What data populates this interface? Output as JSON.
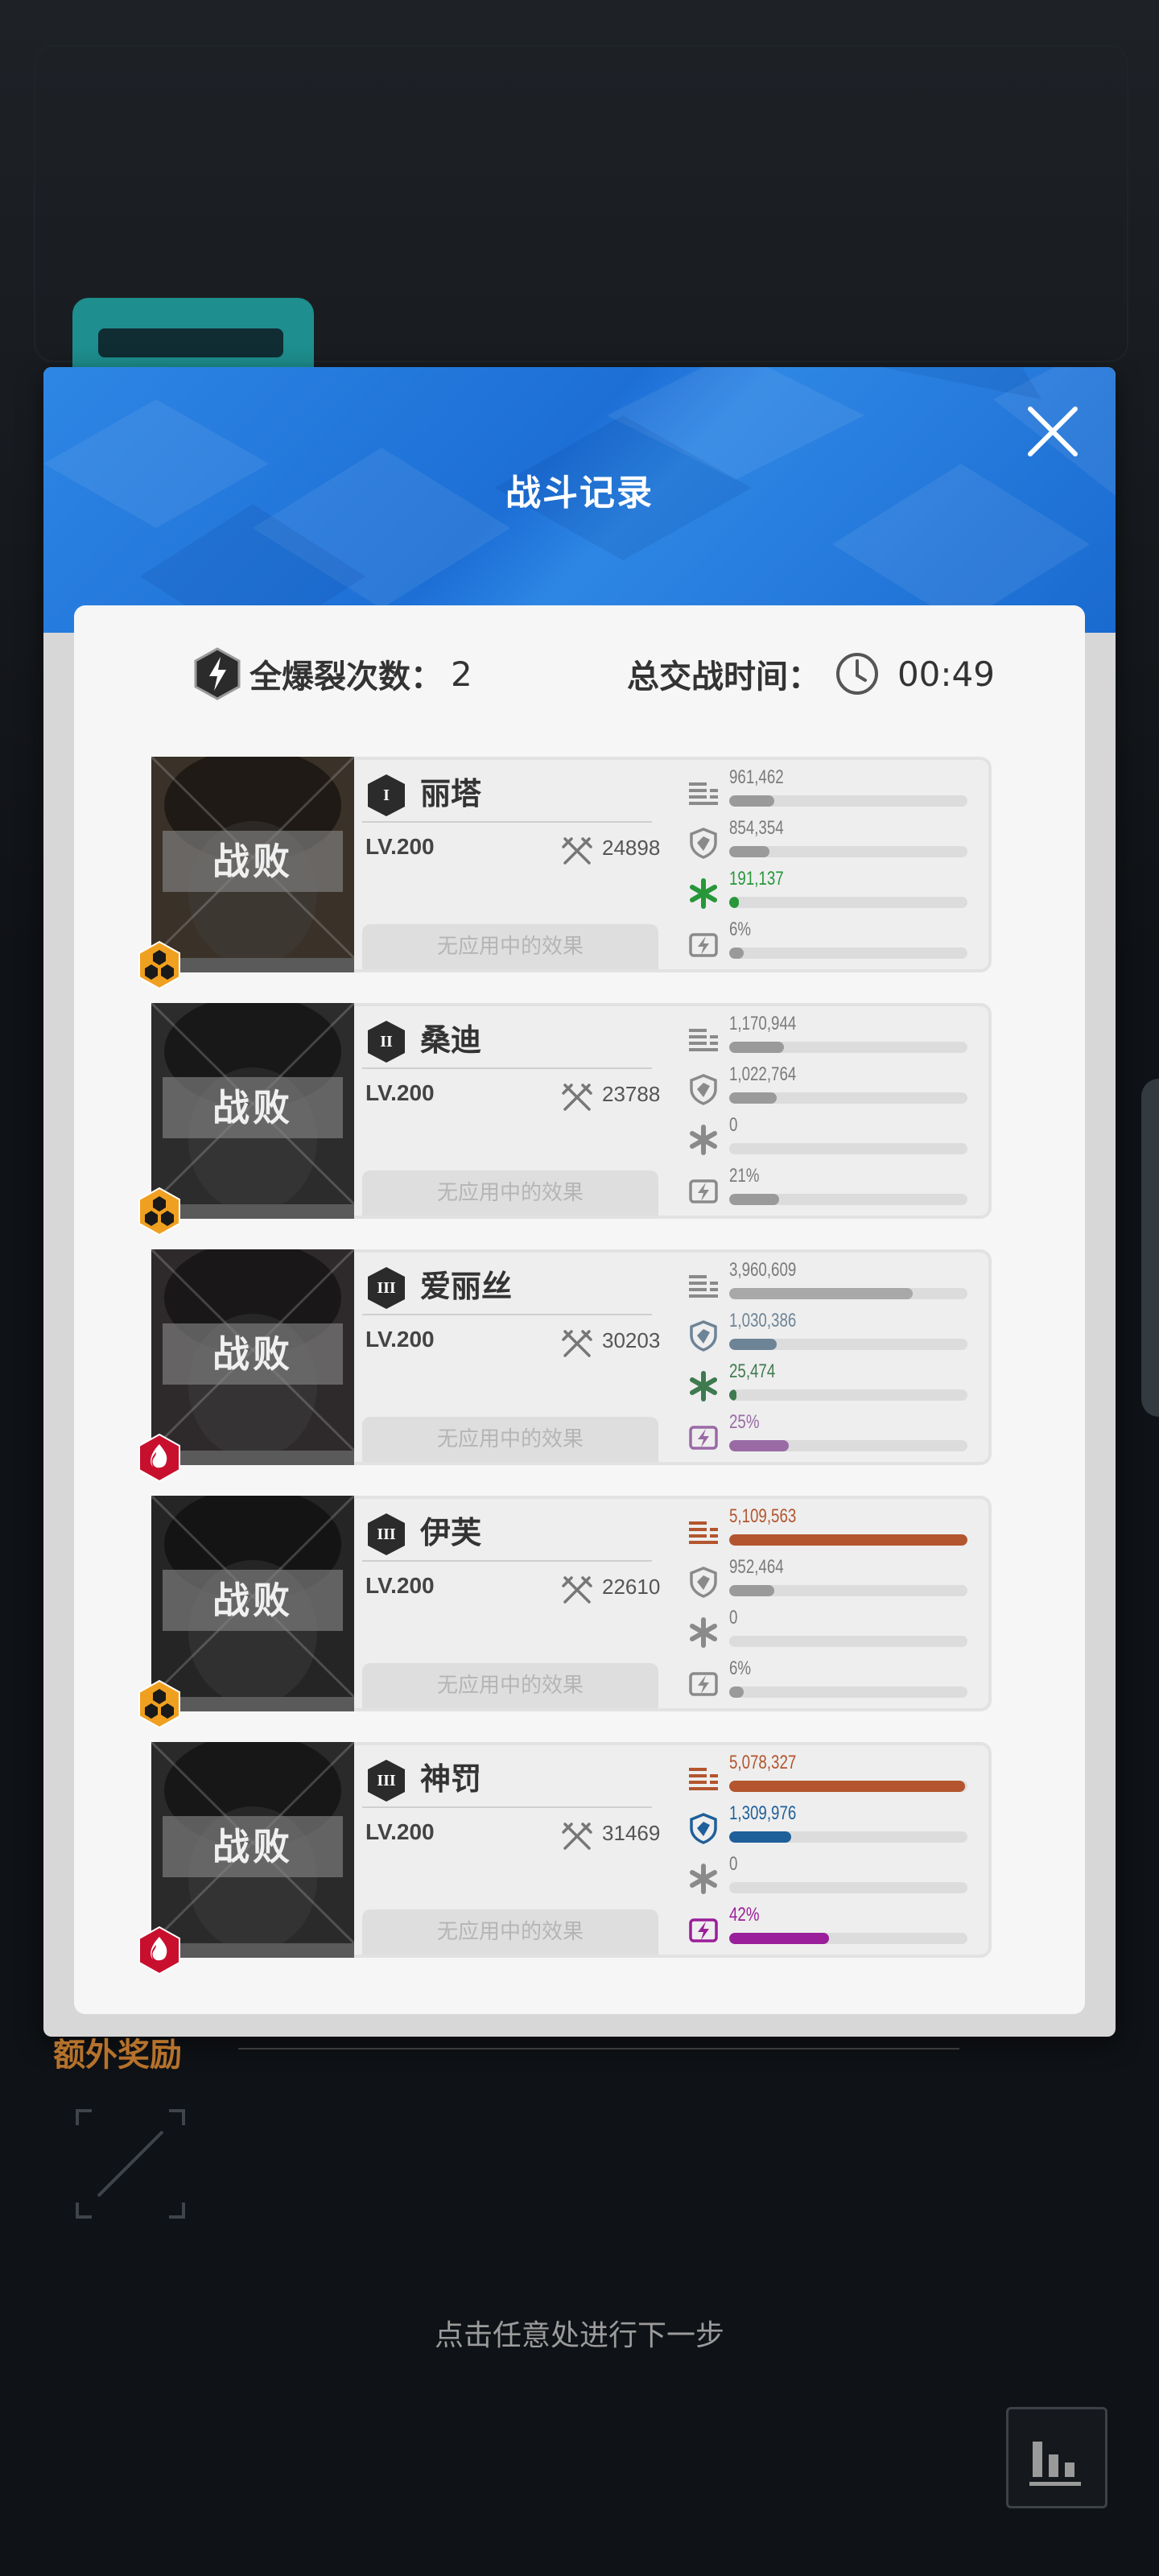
{
  "dialog": {
    "title": "战斗记录",
    "close_icon": "close-icon"
  },
  "summary": {
    "burst_label": "全爆裂次数：",
    "burst_value": "2",
    "time_label": "总交战时间：",
    "time_value": "00:49"
  },
  "characters": [
    {
      "name": "丽塔",
      "rank": "I",
      "level": "LV.200",
      "power": "24898",
      "status": "战败",
      "effects": "无应用中的效果",
      "element": "iron",
      "stats": {
        "damage": {
          "value": "961,462",
          "fraction": 0.19,
          "color": "#9a9a9a"
        },
        "taken": {
          "value": "854,354",
          "fraction": 0.17,
          "color": "#9a9a9a"
        },
        "heal": {
          "value": "191,137",
          "fraction": 0.04,
          "color": "#27973a",
          "highlight": true
        },
        "burst": {
          "value": "6%",
          "fraction": 0.06,
          "color": "#9a9a9a"
        }
      }
    },
    {
      "name": "桑迪",
      "rank": "II",
      "level": "LV.200",
      "power": "23788",
      "status": "战败",
      "effects": "无应用中的效果",
      "element": "iron",
      "stats": {
        "damage": {
          "value": "1,170,944",
          "fraction": 0.23,
          "color": "#9a9a9a"
        },
        "taken": {
          "value": "1,022,764",
          "fraction": 0.2,
          "color": "#9a9a9a"
        },
        "heal": {
          "value": "0",
          "fraction": 0.0,
          "color": "#9a9a9a"
        },
        "burst": {
          "value": "21%",
          "fraction": 0.21,
          "color": "#9a9a9a"
        }
      }
    },
    {
      "name": "爱丽丝",
      "rank": "III",
      "level": "LV.200",
      "power": "30203",
      "status": "战败",
      "effects": "无应用中的效果",
      "element": "fire",
      "stats": {
        "damage": {
          "value": "3,960,609",
          "fraction": 0.77,
          "color": "#a8a8a8"
        },
        "taken": {
          "value": "1,030,386",
          "fraction": 0.2,
          "color": "#6d8396",
          "highlight": true
        },
        "heal": {
          "value": "25,474",
          "fraction": 0.01,
          "color": "#3f7a4f",
          "highlight": true
        },
        "burst": {
          "value": "25%",
          "fraction": 0.25,
          "color": "#9a6aa5",
          "highlight": true
        }
      }
    },
    {
      "name": "伊芙",
      "rank": "III",
      "level": "LV.200",
      "power": "22610",
      "status": "战败",
      "effects": "无应用中的效果",
      "element": "iron",
      "stats": {
        "damage": {
          "value": "5,109,563",
          "fraction": 1.0,
          "color": "#b3552e",
          "highlight": true
        },
        "taken": {
          "value": "952,464",
          "fraction": 0.19,
          "color": "#9a9a9a"
        },
        "heal": {
          "value": "0",
          "fraction": 0.0,
          "color": "#9a9a9a"
        },
        "burst": {
          "value": "6%",
          "fraction": 0.06,
          "color": "#9a9a9a"
        }
      }
    },
    {
      "name": "神罚",
      "rank": "III",
      "level": "LV.200",
      "power": "31469",
      "status": "战败",
      "effects": "无应用中的效果",
      "element": "fire",
      "stats": {
        "damage": {
          "value": "5,078,327",
          "fraction": 0.99,
          "color": "#b3552e",
          "highlight": true
        },
        "taken": {
          "value": "1,309,976",
          "fraction": 0.26,
          "color": "#1f5f9a",
          "highlight": true
        },
        "heal": {
          "value": "0",
          "fraction": 0.0,
          "color": "#9a9a9a"
        },
        "burst": {
          "value": "42%",
          "fraction": 0.42,
          "color": "#9a1f9a",
          "highlight": true
        }
      }
    }
  ],
  "bonus": {
    "label": "额外奖励"
  },
  "footer": {
    "hint": "点击任意处进行下一步",
    "stats_button_icon": "bar-chart-icon"
  }
}
